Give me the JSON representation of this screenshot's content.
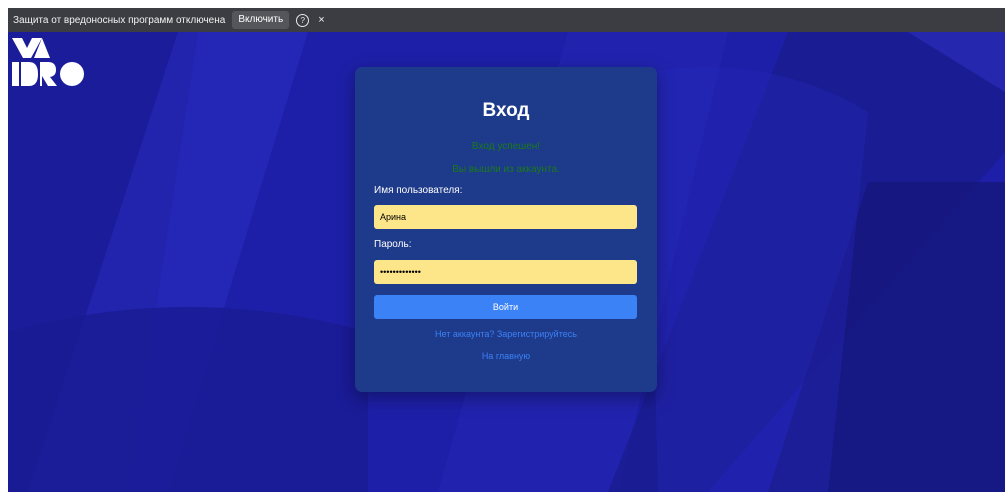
{
  "security_bar": {
    "warning_text": "Защита от вредоносных программ отключена",
    "enable_label": "Включить",
    "help_glyph": "?",
    "close_glyph": "×"
  },
  "brand": {
    "logo_icon": "yadro-logo",
    "logo_color": "#ffffff"
  },
  "login_card": {
    "title": "Вход",
    "messages": [
      "Вход успешен!",
      "Вы вышли из аккаунта."
    ],
    "username_label": "Имя пользователя:",
    "username_value": "Арина",
    "password_label": "Пароль:",
    "password_value": "•••••••••••••",
    "submit_label": "Войти",
    "register_link": "Нет аккаунта? Зарегистрируйтесь",
    "home_link": "На главную"
  },
  "colors": {
    "background": "#1d1fa8",
    "card": "#1e3a8a",
    "input": "#fde68a",
    "button": "#3b82f6",
    "link": "#3b82f6",
    "success_message": "#1a7a1a"
  }
}
